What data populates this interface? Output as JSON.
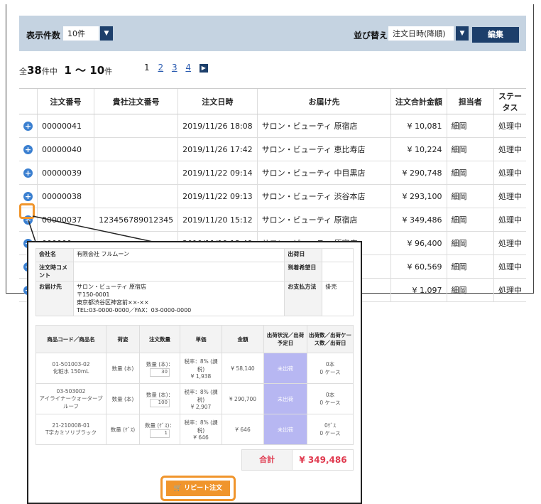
{
  "toolbar": {
    "display_count_label": "表示件数",
    "display_count_value": "10件",
    "sort_label": "並び替え",
    "sort_value": "注文日時(降順)",
    "edit_label": "編集"
  },
  "summary": {
    "prefix": "全",
    "total": "38",
    "mid": "件中",
    "range": "1 ～ 10",
    "suffix": "件"
  },
  "pager": {
    "pages": [
      "1",
      "2",
      "3",
      "4"
    ],
    "current": "1"
  },
  "table": {
    "headers": [
      "",
      "注文番号",
      "貴社注文番号",
      "注文日時",
      "お届け先",
      "注文合計金額",
      "担当者",
      "ステータス"
    ],
    "rows": [
      {
        "no": "00000041",
        "client_no": "",
        "date": "2019/11/26 18:08",
        "dest": "サロン・ビューティ 原宿店",
        "amount": "¥ 10,081",
        "staff": "細岡",
        "status": "処理中"
      },
      {
        "no": "00000040",
        "client_no": "",
        "date": "2019/11/26 17:42",
        "dest": "サロン・ビューティ 恵比寿店",
        "amount": "¥ 10,224",
        "staff": "細岡",
        "status": "処理中"
      },
      {
        "no": "00000039",
        "client_no": "",
        "date": "2019/11/22 09:14",
        "dest": "サロン・ビューティ 中目黒店",
        "amount": "¥ 290,748",
        "staff": "細岡",
        "status": "処理中"
      },
      {
        "no": "00000038",
        "client_no": "",
        "date": "2019/11/22 09:13",
        "dest": "サロン・ビューティ 渋谷本店",
        "amount": "¥ 293,100",
        "staff": "細岡",
        "status": "処理中"
      },
      {
        "no": "00000037",
        "client_no": "123456789012345",
        "date": "2019/11/20 15:12",
        "dest": "サロン・ビューティ 原宿店",
        "amount": "¥ 349,486",
        "staff": "細岡",
        "status": "処理中"
      },
      {
        "no": "000000",
        "client_no": "",
        "date": "2019/11/19 13:49",
        "dest": "サロン・ビューティ 原宿店",
        "amount": "¥ 96,400",
        "staff": "細岡",
        "status": "処理中"
      },
      {
        "no": "",
        "client_no": "",
        "date": "",
        "dest": "",
        "amount": "¥ 60,569",
        "staff": "細岡",
        "status": "処理中"
      },
      {
        "no": "",
        "client_no": "",
        "date": "",
        "dest": "",
        "amount": "¥ 1,097",
        "staff": "細岡",
        "status": "処理中"
      }
    ]
  },
  "detail": {
    "info": {
      "company_label": "会社名",
      "company": "有限会社 フルムーン",
      "ship_date_label": "出荷日",
      "ship_date": "",
      "comment_label": "注文時コメント",
      "comment": "",
      "arrival_label": "到着希望日",
      "arrival": "",
      "dest_label": "お届け先",
      "dest_name": "サロン・ビューティ 原宿店",
      "dest_zip": "〒150-0001",
      "dest_addr": "東京都渋谷区神宮前××-××",
      "dest_tel": "TEL:03-0000-0000／FAX：03-0000-0000",
      "payment_label": "お支払方法",
      "payment": "掛売"
    },
    "item_headers": [
      "商品コード／商品名",
      "荷姿",
      "注文数量",
      "単価",
      "金額",
      "出荷状況／出荷予定日",
      "出荷数／出荷ケース数／出荷日"
    ],
    "items": [
      {
        "code": "01-501003-02",
        "name": "化粧水 150mL",
        "pack": "数量 (本)",
        "qty_label": "数量 (本)：",
        "qty": "30",
        "price_line1": "税率：8% (課",
        "price_line2": "税)",
        "price": "¥ 1,938",
        "amount": "¥ 58,140",
        "status": "未出荷",
        "ship1": "0本",
        "ship2": "0 ケース"
      },
      {
        "code": "03-503002",
        "name": "アイライナーウォータープルーフ",
        "pack": "数量 (本)",
        "qty_label": "数量 (本)：",
        "qty": "100",
        "price_line1": "税率：8% (課",
        "price_line2": "税)",
        "price": "¥ 2,907",
        "amount": "¥ 290,700",
        "status": "未出荷",
        "ship1": "0本",
        "ship2": "0 ケース"
      },
      {
        "code": "21-210008-01",
        "name": "T字カミソリブラック",
        "pack": "数量 (ｹﾞｽ)",
        "qty_label": "数量 (ｹﾞｽ)：",
        "qty": "1",
        "price_line1": "税率：8% (課",
        "price_line2": "税)",
        "price": "¥ 646",
        "amount": "¥ 646",
        "status": "未出荷",
        "ship1": "0ｹﾞｽ",
        "ship2": "0 ケース"
      }
    ],
    "total_label": "合計",
    "total_value": "¥ 349,486",
    "repeat_label": "リピート注文"
  }
}
